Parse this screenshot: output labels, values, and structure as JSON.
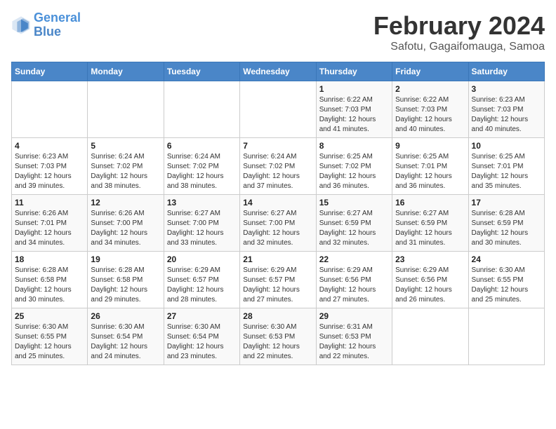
{
  "header": {
    "logo_line1": "General",
    "logo_line2": "Blue",
    "title": "February 2024",
    "subtitle": "Safotu, Gagaifomauga, Samoa"
  },
  "days_of_week": [
    "Sunday",
    "Monday",
    "Tuesday",
    "Wednesday",
    "Thursday",
    "Friday",
    "Saturday"
  ],
  "weeks": [
    [
      {
        "day": "",
        "info": ""
      },
      {
        "day": "",
        "info": ""
      },
      {
        "day": "",
        "info": ""
      },
      {
        "day": "",
        "info": ""
      },
      {
        "day": "1",
        "info": "Sunrise: 6:22 AM\nSunset: 7:03 PM\nDaylight: 12 hours\nand 41 minutes."
      },
      {
        "day": "2",
        "info": "Sunrise: 6:22 AM\nSunset: 7:03 PM\nDaylight: 12 hours\nand 40 minutes."
      },
      {
        "day": "3",
        "info": "Sunrise: 6:23 AM\nSunset: 7:03 PM\nDaylight: 12 hours\nand 40 minutes."
      }
    ],
    [
      {
        "day": "4",
        "info": "Sunrise: 6:23 AM\nSunset: 7:03 PM\nDaylight: 12 hours\nand 39 minutes."
      },
      {
        "day": "5",
        "info": "Sunrise: 6:24 AM\nSunset: 7:02 PM\nDaylight: 12 hours\nand 38 minutes."
      },
      {
        "day": "6",
        "info": "Sunrise: 6:24 AM\nSunset: 7:02 PM\nDaylight: 12 hours\nand 38 minutes."
      },
      {
        "day": "7",
        "info": "Sunrise: 6:24 AM\nSunset: 7:02 PM\nDaylight: 12 hours\nand 37 minutes."
      },
      {
        "day": "8",
        "info": "Sunrise: 6:25 AM\nSunset: 7:02 PM\nDaylight: 12 hours\nand 36 minutes."
      },
      {
        "day": "9",
        "info": "Sunrise: 6:25 AM\nSunset: 7:01 PM\nDaylight: 12 hours\nand 36 minutes."
      },
      {
        "day": "10",
        "info": "Sunrise: 6:25 AM\nSunset: 7:01 PM\nDaylight: 12 hours\nand 35 minutes."
      }
    ],
    [
      {
        "day": "11",
        "info": "Sunrise: 6:26 AM\nSunset: 7:01 PM\nDaylight: 12 hours\nand 34 minutes."
      },
      {
        "day": "12",
        "info": "Sunrise: 6:26 AM\nSunset: 7:00 PM\nDaylight: 12 hours\nand 34 minutes."
      },
      {
        "day": "13",
        "info": "Sunrise: 6:27 AM\nSunset: 7:00 PM\nDaylight: 12 hours\nand 33 minutes."
      },
      {
        "day": "14",
        "info": "Sunrise: 6:27 AM\nSunset: 7:00 PM\nDaylight: 12 hours\nand 32 minutes."
      },
      {
        "day": "15",
        "info": "Sunrise: 6:27 AM\nSunset: 6:59 PM\nDaylight: 12 hours\nand 32 minutes."
      },
      {
        "day": "16",
        "info": "Sunrise: 6:27 AM\nSunset: 6:59 PM\nDaylight: 12 hours\nand 31 minutes."
      },
      {
        "day": "17",
        "info": "Sunrise: 6:28 AM\nSunset: 6:59 PM\nDaylight: 12 hours\nand 30 minutes."
      }
    ],
    [
      {
        "day": "18",
        "info": "Sunrise: 6:28 AM\nSunset: 6:58 PM\nDaylight: 12 hours\nand 30 minutes."
      },
      {
        "day": "19",
        "info": "Sunrise: 6:28 AM\nSunset: 6:58 PM\nDaylight: 12 hours\nand 29 minutes."
      },
      {
        "day": "20",
        "info": "Sunrise: 6:29 AM\nSunset: 6:57 PM\nDaylight: 12 hours\nand 28 minutes."
      },
      {
        "day": "21",
        "info": "Sunrise: 6:29 AM\nSunset: 6:57 PM\nDaylight: 12 hours\nand 27 minutes."
      },
      {
        "day": "22",
        "info": "Sunrise: 6:29 AM\nSunset: 6:56 PM\nDaylight: 12 hours\nand 27 minutes."
      },
      {
        "day": "23",
        "info": "Sunrise: 6:29 AM\nSunset: 6:56 PM\nDaylight: 12 hours\nand 26 minutes."
      },
      {
        "day": "24",
        "info": "Sunrise: 6:30 AM\nSunset: 6:55 PM\nDaylight: 12 hours\nand 25 minutes."
      }
    ],
    [
      {
        "day": "25",
        "info": "Sunrise: 6:30 AM\nSunset: 6:55 PM\nDaylight: 12 hours\nand 25 minutes."
      },
      {
        "day": "26",
        "info": "Sunrise: 6:30 AM\nSunset: 6:54 PM\nDaylight: 12 hours\nand 24 minutes."
      },
      {
        "day": "27",
        "info": "Sunrise: 6:30 AM\nSunset: 6:54 PM\nDaylight: 12 hours\nand 23 minutes."
      },
      {
        "day": "28",
        "info": "Sunrise: 6:30 AM\nSunset: 6:53 PM\nDaylight: 12 hours\nand 22 minutes."
      },
      {
        "day": "29",
        "info": "Sunrise: 6:31 AM\nSunset: 6:53 PM\nDaylight: 12 hours\nand 22 minutes."
      },
      {
        "day": "",
        "info": ""
      },
      {
        "day": "",
        "info": ""
      }
    ]
  ]
}
